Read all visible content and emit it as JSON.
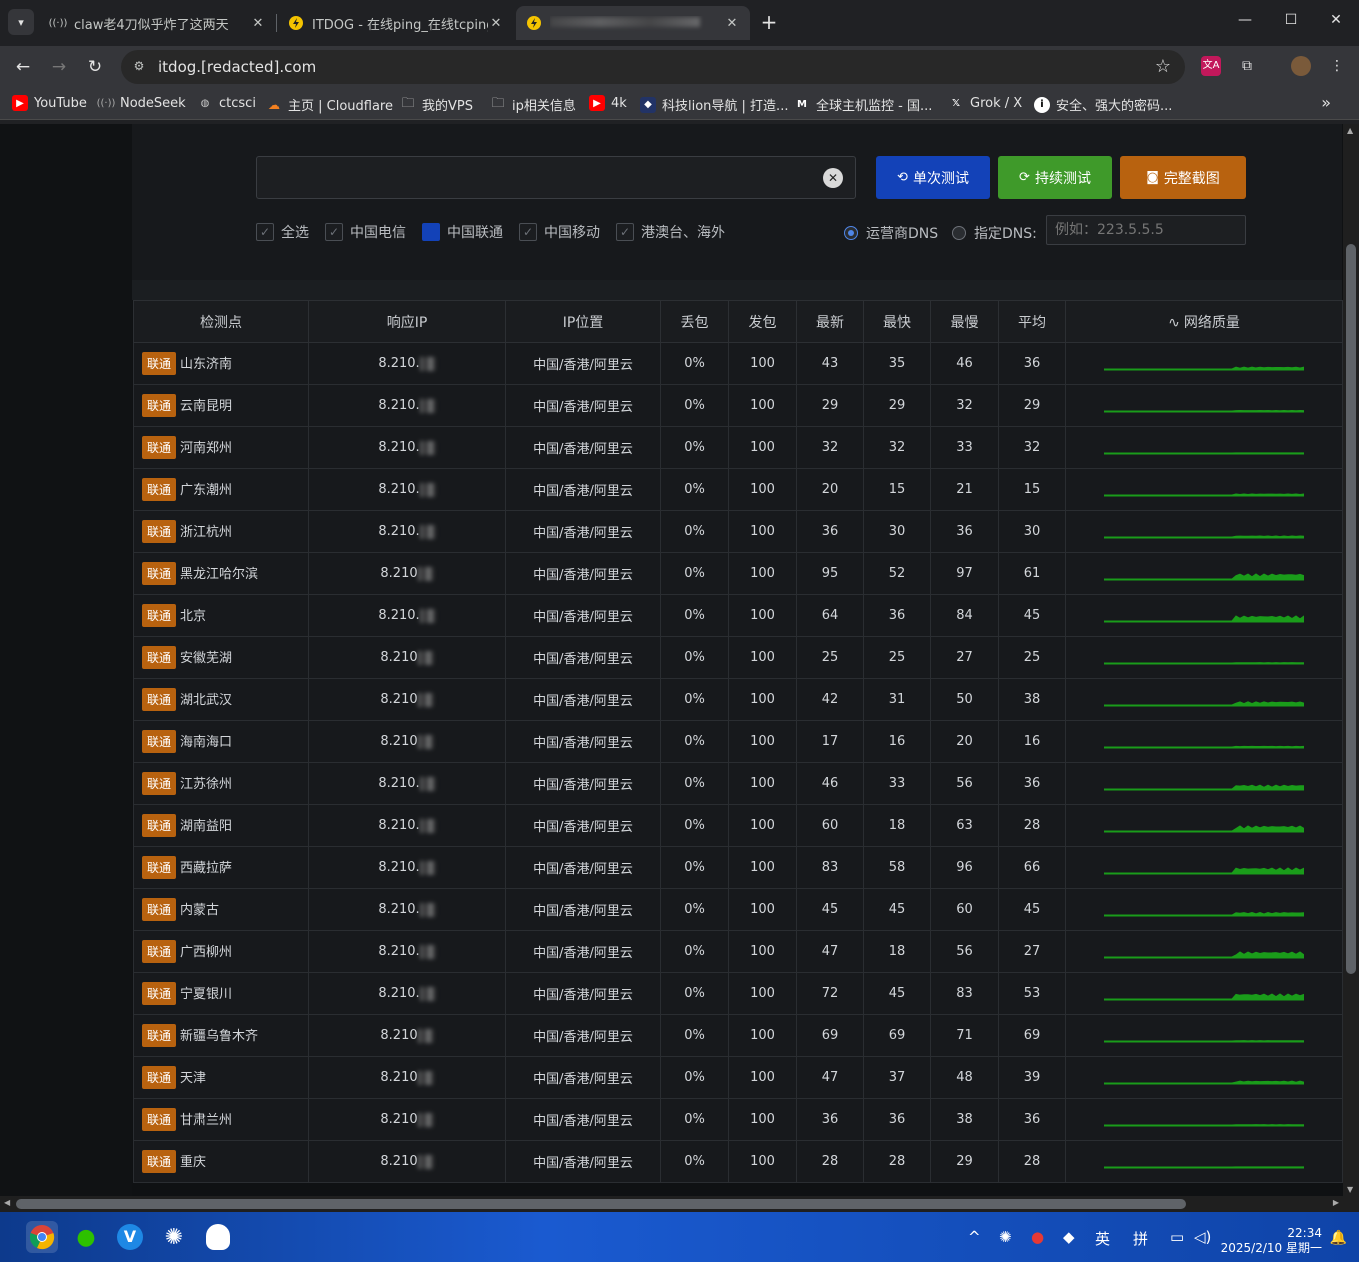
{
  "tabs": [
    {
      "title": "claw老4刀似乎炸了这两天",
      "icon": "broadcast-icon"
    },
    {
      "title": "ITDOG - 在线ping_在线tcping",
      "icon": "itdog-icon"
    },
    {
      "title": "",
      "icon": "itdog-icon"
    }
  ],
  "url": "itdog.[redacted].com",
  "bookmarks": [
    {
      "label": "YouTube",
      "icon": "youtube-icon",
      "color": "#ff0000"
    },
    {
      "label": "NodeSeek",
      "icon": "broadcast-icon",
      "color": "#888888"
    },
    {
      "label": "ctcsci",
      "icon": "globe-icon",
      "color": "#888888"
    },
    {
      "label": "主页 | Cloudflare",
      "icon": "cloudflare-icon",
      "color": "#f38020"
    },
    {
      "label": "我的VPS",
      "icon": "folder-icon",
      "color": "#cccccc"
    },
    {
      "label": "ip相关信息",
      "icon": "folder-icon",
      "color": "#cccccc"
    },
    {
      "label": "4k",
      "icon": "youtube-icon",
      "color": "#ff0000"
    },
    {
      "label": "科技lion导航 | 打造...",
      "icon": "lion-icon",
      "color": "#3355aa"
    },
    {
      "label": "全球主机监控 - 国...",
      "icon": "monitor-icon",
      "color": "#ffffff"
    },
    {
      "label": "Grok / X",
      "icon": "x-icon",
      "color": "#ffffff"
    },
    {
      "label": "安全、强大的密码...",
      "icon": "info-icon",
      "color": "#ffffff"
    }
  ],
  "controls": {
    "btn_single": "单次测试",
    "btn_continuous": "持续测试",
    "btn_screenshot": "完整截图",
    "checkboxes": [
      {
        "label": "全选",
        "checked": false
      },
      {
        "label": "中国电信",
        "checked": false
      },
      {
        "label": "中国联通",
        "checked": true
      },
      {
        "label": "中国移动",
        "checked": false
      },
      {
        "label": "港澳台、海外",
        "checked": false
      }
    ],
    "radio_isp_dns": "运营商DNS",
    "radio_custom_dns": "指定DNS:",
    "dns_placeholder": "例如：223.5.5.5"
  },
  "table": {
    "headers": [
      "检测点",
      "响应IP",
      "IP位置",
      "丢包",
      "发包",
      "最新",
      "最快",
      "最慢",
      "平均",
      "网络质量"
    ],
    "rows": [
      {
        "isp": "联通",
        "node": "山东济南",
        "ip": "8.210.",
        "loc": "中国/香港/阿里云",
        "loss": "0%",
        "sent": "100",
        "last": "43",
        "best": "35",
        "worst": "46",
        "avg": "36"
      },
      {
        "isp": "联通",
        "node": "云南昆明",
        "ip": "8.210.",
        "loc": "中国/香港/阿里云",
        "loss": "0%",
        "sent": "100",
        "last": "29",
        "best": "29",
        "worst": "32",
        "avg": "29"
      },
      {
        "isp": "联通",
        "node": "河南郑州",
        "ip": "8.210.",
        "loc": "中国/香港/阿里云",
        "loss": "0%",
        "sent": "100",
        "last": "32",
        "best": "32",
        "worst": "33",
        "avg": "32"
      },
      {
        "isp": "联通",
        "node": "广东潮州",
        "ip": "8.210.",
        "loc": "中国/香港/阿里云",
        "loss": "0%",
        "sent": "100",
        "last": "20",
        "best": "15",
        "worst": "21",
        "avg": "15"
      },
      {
        "isp": "联通",
        "node": "浙江杭州",
        "ip": "8.210.",
        "loc": "中国/香港/阿里云",
        "loss": "0%",
        "sent": "100",
        "last": "36",
        "best": "30",
        "worst": "36",
        "avg": "30"
      },
      {
        "isp": "联通",
        "node": "黑龙江哈尔滨",
        "ip": "8.210",
        "loc": "中国/香港/阿里云",
        "loss": "0%",
        "sent": "100",
        "last": "95",
        "best": "52",
        "worst": "97",
        "avg": "61"
      },
      {
        "isp": "联通",
        "node": "北京",
        "ip": "8.210.",
        "loc": "中国/香港/阿里云",
        "loss": "0%",
        "sent": "100",
        "last": "64",
        "best": "36",
        "worst": "84",
        "avg": "45"
      },
      {
        "isp": "联通",
        "node": "安徽芜湖",
        "ip": "8.210",
        "loc": "中国/香港/阿里云",
        "loss": "0%",
        "sent": "100",
        "last": "25",
        "best": "25",
        "worst": "27",
        "avg": "25"
      },
      {
        "isp": "联通",
        "node": "湖北武汉",
        "ip": "8.210",
        "loc": "中国/香港/阿里云",
        "loss": "0%",
        "sent": "100",
        "last": "42",
        "best": "31",
        "worst": "50",
        "avg": "38"
      },
      {
        "isp": "联通",
        "node": "海南海口",
        "ip": "8.210",
        "loc": "中国/香港/阿里云",
        "loss": "0%",
        "sent": "100",
        "last": "17",
        "best": "16",
        "worst": "20",
        "avg": "16"
      },
      {
        "isp": "联通",
        "node": "江苏徐州",
        "ip": "8.210.",
        "loc": "中国/香港/阿里云",
        "loss": "0%",
        "sent": "100",
        "last": "46",
        "best": "33",
        "worst": "56",
        "avg": "36"
      },
      {
        "isp": "联通",
        "node": "湖南益阳",
        "ip": "8.210.",
        "loc": "中国/香港/阿里云",
        "loss": "0%",
        "sent": "100",
        "last": "60",
        "best": "18",
        "worst": "63",
        "avg": "28"
      },
      {
        "isp": "联通",
        "node": "西藏拉萨",
        "ip": "8.210.",
        "loc": "中国/香港/阿里云",
        "loss": "0%",
        "sent": "100",
        "last": "83",
        "best": "58",
        "worst": "96",
        "avg": "66"
      },
      {
        "isp": "联通",
        "node": "内蒙古",
        "ip": "8.210.",
        "loc": "中国/香港/阿里云",
        "loss": "0%",
        "sent": "100",
        "last": "45",
        "best": "45",
        "worst": "60",
        "avg": "45"
      },
      {
        "isp": "联通",
        "node": "广西柳州",
        "ip": "8.210.",
        "loc": "中国/香港/阿里云",
        "loss": "0%",
        "sent": "100",
        "last": "47",
        "best": "18",
        "worst": "56",
        "avg": "27"
      },
      {
        "isp": "联通",
        "node": "宁夏银川",
        "ip": "8.210.",
        "loc": "中国/香港/阿里云",
        "loss": "0%",
        "sent": "100",
        "last": "72",
        "best": "45",
        "worst": "83",
        "avg": "53"
      },
      {
        "isp": "联通",
        "node": "新疆乌鲁木齐",
        "ip": "8.210",
        "loc": "中国/香港/阿里云",
        "loss": "0%",
        "sent": "100",
        "last": "69",
        "best": "69",
        "worst": "71",
        "avg": "69"
      },
      {
        "isp": "联通",
        "node": "天津",
        "ip": "8.210",
        "loc": "中国/香港/阿里云",
        "loss": "0%",
        "sent": "100",
        "last": "47",
        "best": "37",
        "worst": "48",
        "avg": "39"
      },
      {
        "isp": "联通",
        "node": "甘肃兰州",
        "ip": "8.210",
        "loc": "中国/香港/阿里云",
        "loss": "0%",
        "sent": "100",
        "last": "36",
        "best": "36",
        "worst": "38",
        "avg": "36"
      },
      {
        "isp": "联通",
        "node": "重庆",
        "ip": "8.210",
        "loc": "中国/香港/阿里云",
        "loss": "0%",
        "sent": "100",
        "last": "28",
        "best": "28",
        "worst": "29",
        "avg": "28"
      }
    ]
  },
  "taskbar": {
    "ime_lang": "英",
    "ime_mode": "拼",
    "time": "22:34",
    "date": "2025/2/10 星期一"
  },
  "colors": {
    "tag_orange": "#b8620f",
    "btn_blue": "#1342b8",
    "btn_green": "#3f9a2a",
    "spark_green": "#1a9c1a"
  }
}
